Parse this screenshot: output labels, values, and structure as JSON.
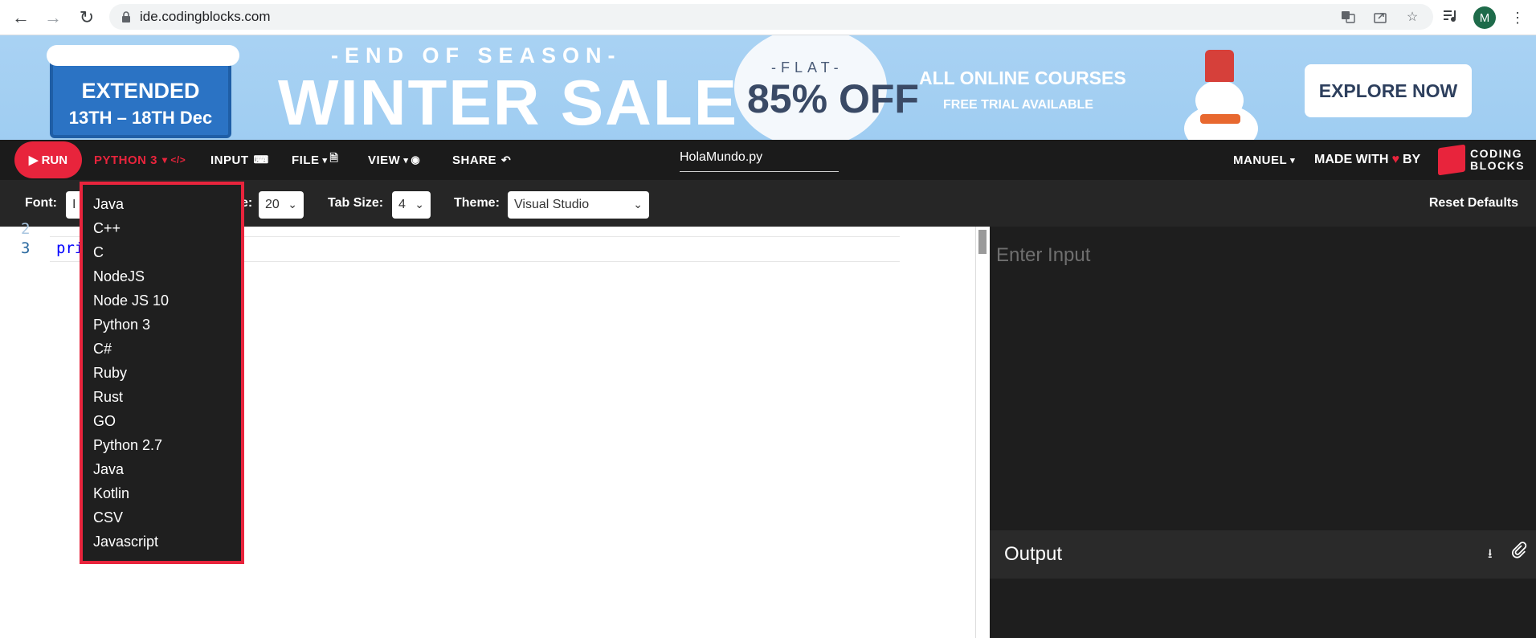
{
  "browser": {
    "url": "ide.codingblocks.com",
    "avatar_letter": "M"
  },
  "banner": {
    "extended": "EXTENDED",
    "dates": "13TH – 18TH Dec",
    "end_of_season": "-END OF SEASON-",
    "title": "WINTER SALE",
    "flat": "-FLAT-",
    "discount": "85% OFF",
    "all_courses": "ALL ONLINE COURSES",
    "free_trial": "FREE TRIAL AVAILABLE",
    "cta": "EXPLORE NOW"
  },
  "navbar": {
    "run": "▶ RUN",
    "language": "PYTHON 3",
    "language_glyph": "▾ </>",
    "input": "INPUT",
    "file": "FILE",
    "view": "VIEW",
    "share": "SHARE",
    "filename": "HolaMundo.py",
    "user": "MANUEL",
    "made_with": "MADE WITH",
    "by": "BY",
    "brand_line1": "CODING",
    "brand_line2": "BLOCKS",
    "accent_color": "#e8243c"
  },
  "toolbar": {
    "font_label": "Font:",
    "font_value": "I",
    "size_label": "e:",
    "size_value": "20",
    "tab_label": "Tab Size:",
    "tab_value": "4",
    "theme_label": "Theme:",
    "theme_value": "Visual Studio",
    "reset": "Reset Defaults"
  },
  "editor": {
    "line_prev": "2",
    "line_num": "3",
    "code_visible": "pri"
  },
  "input_panel": {
    "placeholder": "Enter Input"
  },
  "output_panel": {
    "title": "Output"
  },
  "language_dropdown": {
    "items": [
      "Java",
      "C++",
      "C",
      "NodeJS",
      "Node JS 10",
      "Python 3",
      "C#",
      "Ruby",
      "Rust",
      "GO",
      "Python 2.7",
      "Java",
      "Kotlin",
      "CSV",
      "Javascript"
    ]
  }
}
